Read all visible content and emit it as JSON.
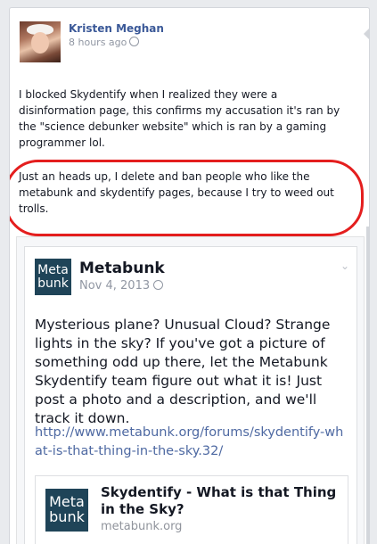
{
  "post": {
    "author": "Kristen Meghan",
    "time": "8 hours ago",
    "paragraph1": "I blocked Skydentify when I realized they were a disinformation page, this confirms my accusation it's ran by the \"science debunker website\" which is ran by a gaming programmer lol.",
    "paragraph2": "Just an heads up, I delete and ban people who like the metabunk and skydentify pages, because I try to weed out trolls."
  },
  "shared": {
    "page_name": "Metabunk",
    "logo_line1": "Meta",
    "logo_line2": "bunk",
    "date": "Nov 4, 2013",
    "text": "Mysterious plane? Unusual Cloud? Strange lights in the sky? If you've got a picture of something odd up there, let the Metabunk Skydentify team figure out what it is! Just post a photo and a description, and we'll track it down.",
    "link": "http://www.metabunk.org/forums/skydentify-what-is-that-thing-in-the-sky.32/",
    "card": {
      "title": "Skydentify - What is that Thing in the Sky?",
      "domain": "metabunk.org"
    }
  },
  "icons": [
    "globe-icon",
    "chevron-down-icon",
    "avatar"
  ],
  "colors": {
    "annotation": "#e41e1e",
    "author": "#3b5998",
    "link": "#4e69a2",
    "logo_bg": "#1f4458"
  }
}
